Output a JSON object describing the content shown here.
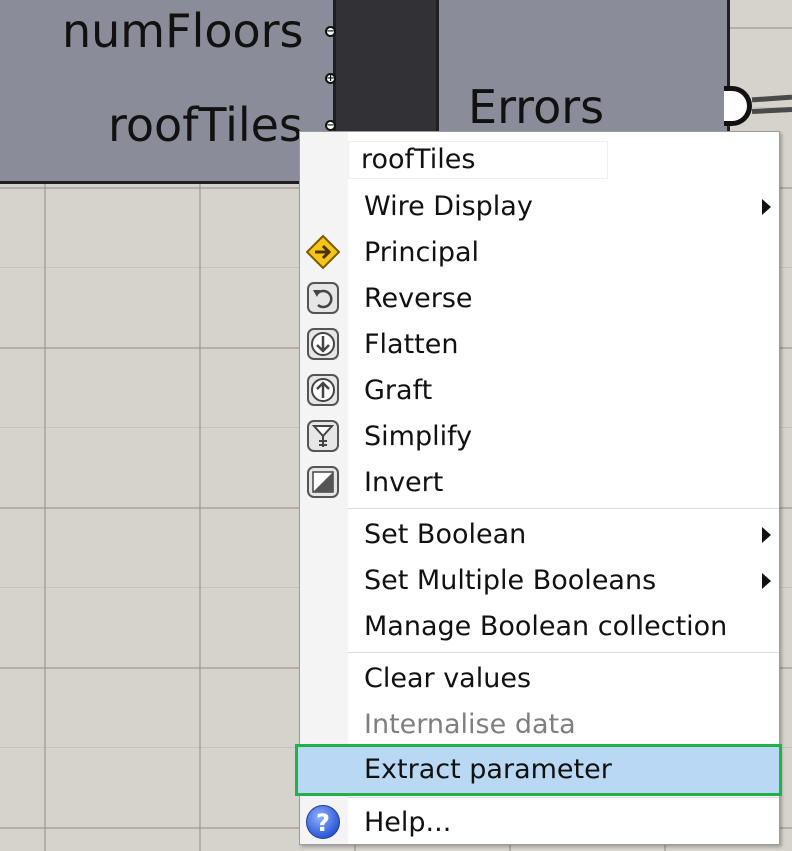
{
  "component": {
    "inputs": [
      {
        "label": "numFloors"
      },
      {
        "label": "roofTiles"
      }
    ],
    "output": {
      "label": "Errors"
    }
  },
  "context_menu": {
    "title": "roofTiles",
    "group1": [
      {
        "label": "Wire Display",
        "submenu": true,
        "icon": ""
      },
      {
        "label": "Principal",
        "icon": "principal-arrow-icon"
      },
      {
        "label": "Reverse",
        "icon": "reverse-icon"
      },
      {
        "label": "Flatten",
        "icon": "flatten-icon"
      },
      {
        "label": "Graft",
        "icon": "graft-icon"
      },
      {
        "label": "Simplify",
        "icon": "simplify-icon"
      },
      {
        "label": "Invert",
        "icon": "invert-icon"
      }
    ],
    "group2": [
      {
        "label": "Set Boolean",
        "submenu": true
      },
      {
        "label": "Set Multiple Booleans",
        "submenu": true
      },
      {
        "label": "Manage Boolean collection"
      }
    ],
    "group3": [
      {
        "label": "Clear values"
      },
      {
        "label": "Internalise data",
        "disabled": true
      },
      {
        "label": "Extract parameter",
        "highlighted": true
      }
    ],
    "help": {
      "label": "Help...",
      "icon": "help-icon",
      "glyph": "?"
    }
  },
  "colors": {
    "canvas": "#d6d3cc",
    "component_body": "#8b8c99",
    "highlight": "#b9d8f3",
    "highlight_outline": "#22b04b",
    "principal_icon": "#f5c518"
  }
}
